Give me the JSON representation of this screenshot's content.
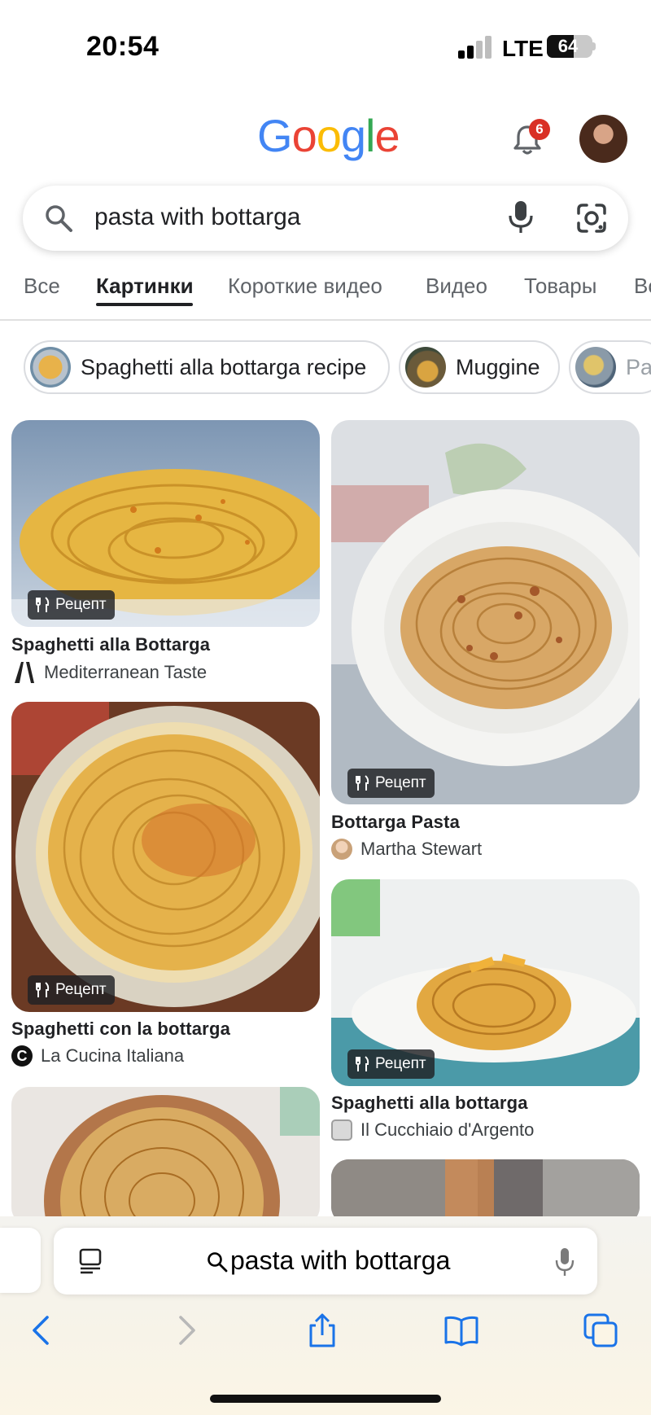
{
  "status_bar": {
    "time": "20:54",
    "network": "LTE",
    "battery": "64",
    "battery_percent": 64
  },
  "header": {
    "logo": [
      "G",
      "o",
      "o",
      "g",
      "l",
      "e"
    ],
    "logo_colors": [
      "#4285F4",
      "#EA4335",
      "#FBBC05",
      "#4285F4",
      "#34A853",
      "#EA4335"
    ],
    "notification_count": "6"
  },
  "search": {
    "query": "pasta with bottarga"
  },
  "tabs": [
    "Все",
    "Картинки",
    "Короткие видео",
    "Видео",
    "Товары",
    "Вс"
  ],
  "active_tab": "Картинки",
  "chips": [
    "Spaghetti alla bottarga recipe",
    "Muggine",
    "Pa"
  ],
  "results": {
    "badge": "Рецепт",
    "items": [
      {
        "title": "Spaghetti alla Bottarga",
        "source": "Mediterranean Taste"
      },
      {
        "title": "Bottarga Pasta",
        "source": "Martha Stewart"
      },
      {
        "title": "Spaghetti con la bottarga",
        "source": "La Cucina Italiana"
      },
      {
        "title": "Spaghetti alla bottarga",
        "source": "Il Cucchiaio d'Argento"
      }
    ]
  },
  "safari": {
    "address": "pasta with bottarga"
  },
  "icons": [
    "search-icon",
    "mic-icon",
    "lens-icon",
    "bell-icon",
    "utensils-icon",
    "reader-icon",
    "back-icon",
    "forward-icon",
    "share-icon",
    "bookmarks-icon",
    "tabs-icon"
  ]
}
